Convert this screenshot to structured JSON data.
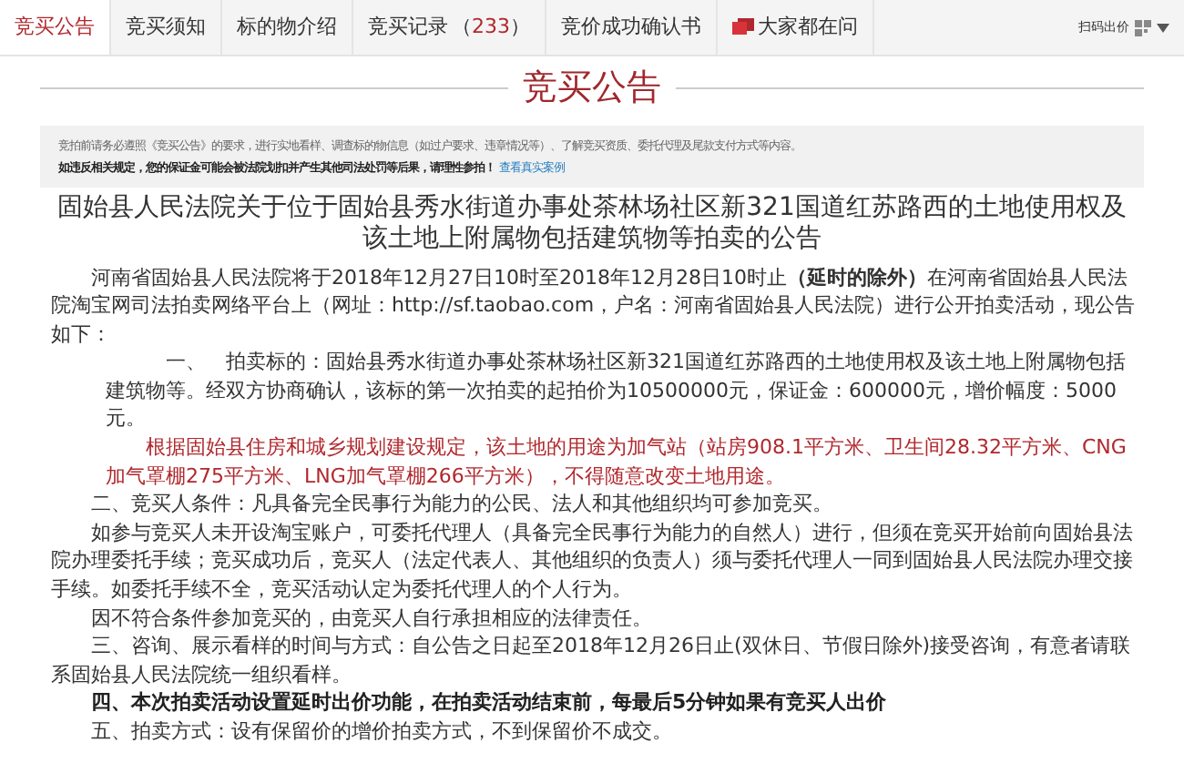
{
  "tabs": [
    {
      "label": "竞买公告",
      "selected": true
    },
    {
      "label": "竞买须知",
      "selected": false
    },
    {
      "label": "标的物介绍",
      "selected": false
    },
    {
      "label": "竞买记录",
      "count_open": "（",
      "count": "233",
      "count_close": "）",
      "selected": false
    },
    {
      "label": "竞价成功确认书",
      "selected": false
    },
    {
      "label": "大家都在问",
      "kind": "faq",
      "selected": false
    }
  ],
  "scan_bid": "扫码出价",
  "heading": "竞买公告",
  "notice": {
    "line1": "竞拍前请务必遵照《竞买公告》的要求，进行实地看样、调查标的物信息（如过户要求、违章情况等）、了解竞买资质、委托代理及尾款支付方式等内容。",
    "line2": "如违反相关规定，您的保证金可能会被法院划扣并产生其他司法处罚等后果，请理性参拍！",
    "link": "查看真实案例"
  },
  "title": "固始县人民法院关于位于固始县秀水街道办事处茶林场社区新321国道红苏路西的土地使用权及该土地上附属物包括建筑物等拍卖的公告",
  "paragraphs": [
    {
      "kind": "normal",
      "text": "河南省固始县人民法院将于2018年12月27日10时至2018年12月28日10时止**（延时的除外）**在河南省固始县人民法院淘宝网司法拍卖网络平台上（网址：http://sf.taobao.com，户名：河南省固始县人民法院）进行公开拍卖活动，现公告如下："
    },
    {
      "kind": "item",
      "text": "一、　拍卖标的：固始县秀水街道办事处茶林场社区新321国道红苏路西的土地使用权及该土地上附属物包括建筑物等。经双方协商确认，该标的第一次拍卖的起拍价为10500000元，保证金：600000元，增价幅度：5000元。"
    },
    {
      "kind": "red",
      "text": "根据固始县住房和城乡规划建设规定，该土地的用途为加气站（站房908.1平方米、卫生间28.32平方米、CNG加气罩棚275平方米、LNG加气罩棚266平方米），不得随意改变土地用途。"
    },
    {
      "kind": "normal",
      "text": "二、竞买人条件：凡具备完全民事行为能力的公民、法人和其他组织均可参加竞买。"
    },
    {
      "kind": "normal",
      "text": "如参与竞买人未开设淘宝账户，可委托代理人（具备完全民事行为能力的自然人）进行，但须在竞买开始前向固始县法院办理委托手续；竞买成功后，竞买人（法定代表人、其他组织的负责人）须与委托代理人一同到固始县人民法院办理交接手续。如委托手续不全，竞买活动认定为委托代理人的个人行为。"
    },
    {
      "kind": "normal",
      "text": "因不符合条件参加竞买的，由竞买人自行承担相应的法律责任。"
    },
    {
      "kind": "normal",
      "text": "三、咨询、展示看样的时间与方式：自公告之日起至2018年12月26日止(双休日、节假日除外)接受咨询，有意者请联系固始县人民法院统一组织看样。"
    },
    {
      "kind": "bold",
      "text": "四、本次拍卖活动设置延时出价功能，在拍卖活动结束前，每最后5分钟如果有竞买人出价"
    },
    {
      "kind": "normal",
      "text": "五、拍卖方式：设有保留价的增价拍卖方式，不到保留价不成交。"
    }
  ]
}
